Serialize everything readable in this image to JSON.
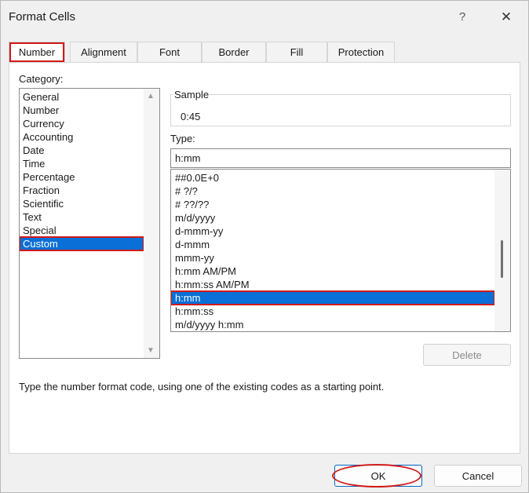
{
  "window": {
    "title": "Format Cells",
    "help": "?",
    "close": "✕"
  },
  "tabs": [
    {
      "label": "Number",
      "active": true
    },
    {
      "label": "Alignment"
    },
    {
      "label": "Font"
    },
    {
      "label": "Border"
    },
    {
      "label": "Fill"
    },
    {
      "label": "Protection"
    }
  ],
  "category": {
    "label": "Category:",
    "items": [
      "General",
      "Number",
      "Currency",
      "Accounting",
      "Date",
      "Time",
      "Percentage",
      "Fraction",
      "Scientific",
      "Text",
      "Special",
      "Custom"
    ],
    "selected": "Custom"
  },
  "sample": {
    "label": "Sample",
    "value": "0:45"
  },
  "type": {
    "label": "Type:",
    "input_value": "h:mm",
    "items": [
      "##0.0E+0",
      "# ?/?",
      "# ??/??",
      "m/d/yyyy",
      "d-mmm-yy",
      "d-mmm",
      "mmm-yy",
      "h:mm AM/PM",
      "h:mm:ss AM/PM",
      "h:mm",
      "h:mm:ss",
      "m/d/yyyy h:mm"
    ],
    "selected": "h:mm"
  },
  "buttons": {
    "delete": "Delete",
    "ok": "OK",
    "cancel": "Cancel"
  },
  "hint": "Type the number format code, using one of the existing codes as a starting point.",
  "icons": {
    "scroll_up": "▲",
    "scroll_down": "▼"
  },
  "colors": {
    "selection": "#0a6fd6",
    "annotation": "#d11a1a"
  }
}
